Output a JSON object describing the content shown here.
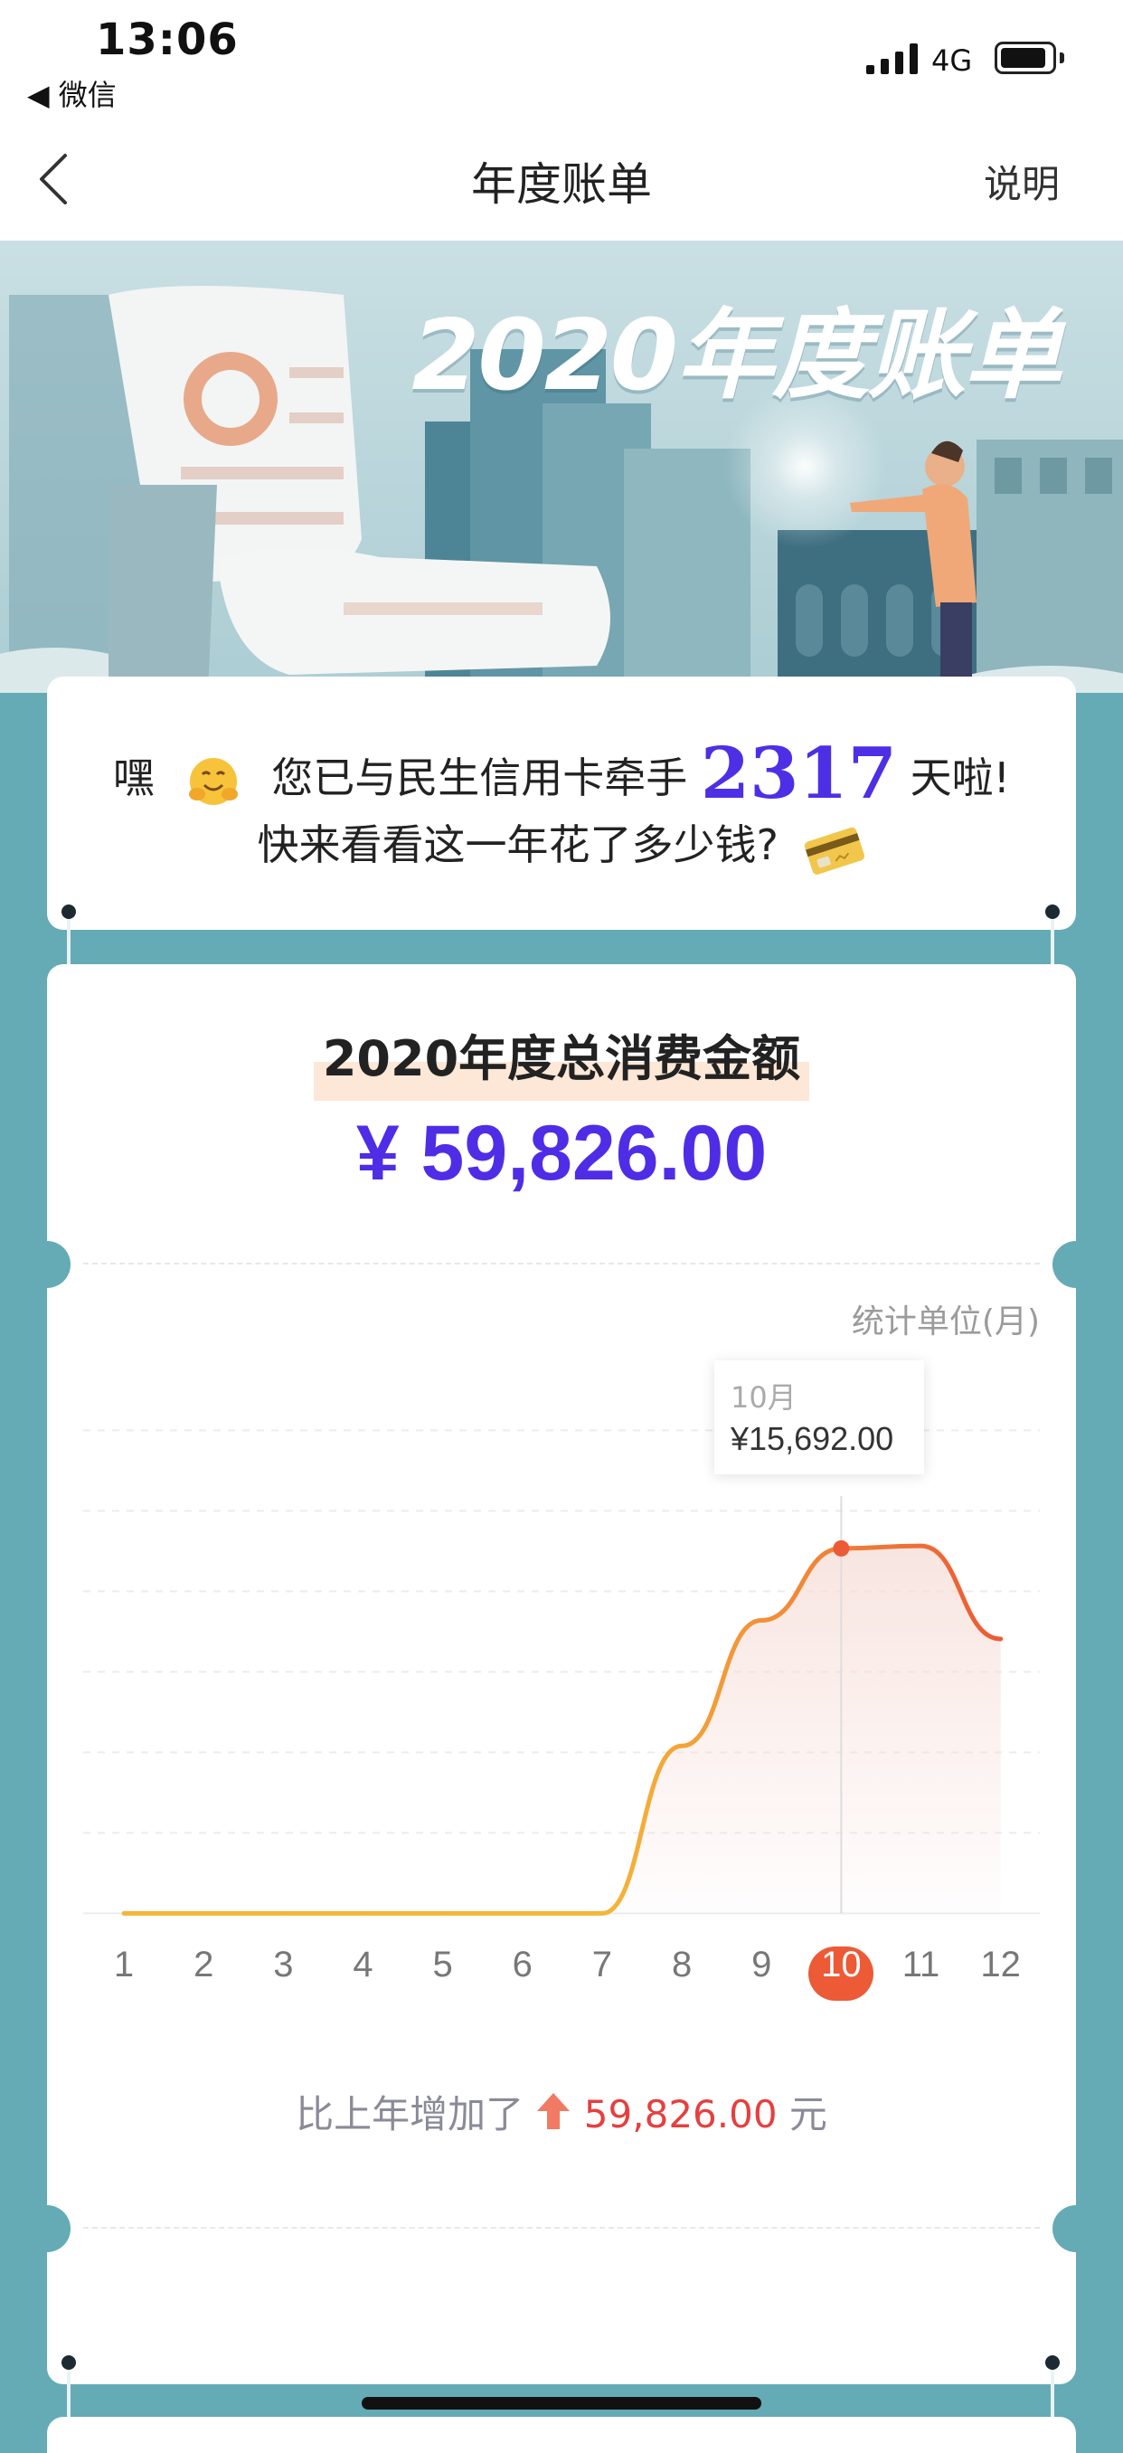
{
  "status_bar": {
    "time": "13:06",
    "back_app": "◀ 微信",
    "network": "4G",
    "battery_level": 0.9
  },
  "nav": {
    "title": "年度账单",
    "help": "说明"
  },
  "banner": {
    "title": "2020年度账单"
  },
  "greeting": {
    "prefix": "嘿",
    "middle": "您已与民生信用卡牵手",
    "days": "2317",
    "suffix": "天啦!",
    "line2": "快来看看这一年花了多少钱?"
  },
  "summary": {
    "title": "2020年度总消费金额",
    "total": "¥ 59,826.00",
    "unit_label": "统计单位(月)",
    "tooltip_month": "10月",
    "tooltip_value": "¥15,692.00",
    "compare_prefix": "比上年增加了",
    "compare_amount": "59,826.00",
    "compare_suffix": "元"
  },
  "chart_data": {
    "type": "area",
    "categories": [
      "1",
      "2",
      "3",
      "4",
      "5",
      "6",
      "7",
      "8",
      "9",
      "10",
      "11",
      "12"
    ],
    "values": [
      0,
      0,
      0,
      0,
      0,
      0,
      0,
      7200,
      12600,
      15692,
      15800,
      11800
    ],
    "highlight_index": 9,
    "ylim": [
      0,
      18000
    ],
    "grid": true,
    "colors": {
      "line_start": "#f5b53a",
      "line_end": "#ec5a36",
      "fill": "#f6dcd6",
      "highlight": "#ec5a36"
    }
  }
}
